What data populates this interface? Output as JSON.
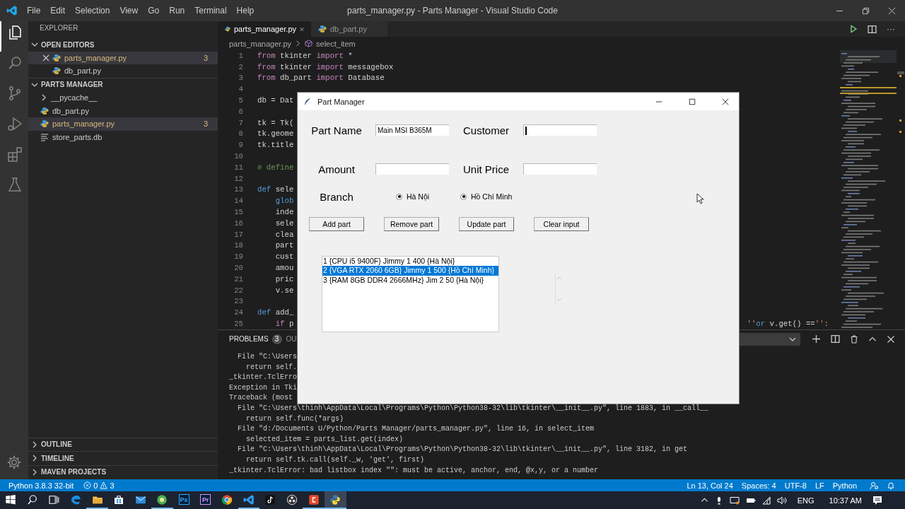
{
  "titlebar": {
    "menu": [
      "File",
      "Edit",
      "Selection",
      "View",
      "Go",
      "Run",
      "Terminal",
      "Help"
    ],
    "title": "parts_manager.py - Parts Manager - Visual Studio Code"
  },
  "activity": [
    {
      "kind": "files",
      "selected": true
    },
    {
      "kind": "search",
      "selected": false
    },
    {
      "kind": "source-control",
      "selected": false
    },
    {
      "kind": "run",
      "selected": false
    },
    {
      "kind": "extensions",
      "selected": false
    },
    {
      "kind": "flask",
      "selected": false
    }
  ],
  "sidebar": {
    "title": "EXPLORER",
    "sections": [
      {
        "label": "OPEN EDITORS",
        "expanded": true,
        "items": [
          {
            "label": "parts_manager.py",
            "kind": "python",
            "badge": "3",
            "modified": true,
            "selected": true
          },
          {
            "label": "db_part.py",
            "kind": "python",
            "modified": false,
            "selected": false
          }
        ]
      },
      {
        "label": "PARTS MANAGER",
        "expanded": true,
        "items": [
          {
            "label": "__pycache__",
            "kind": "folder",
            "modified": false,
            "selected": false
          },
          {
            "label": "db_part.py",
            "kind": "python",
            "modified": false,
            "selected": false
          },
          {
            "label": "parts_manager.py",
            "kind": "python",
            "badge": "3",
            "modified": true,
            "selected": true
          },
          {
            "label": "store_parts.db",
            "kind": "file",
            "modified": false,
            "selected": false
          }
        ]
      }
    ],
    "bottom_sections": [
      {
        "label": "OUTLINE",
        "expanded": false
      },
      {
        "label": "TIMELINE",
        "expanded": false
      },
      {
        "label": "MAVEN PROJECTS",
        "expanded": false
      }
    ]
  },
  "tabs": [
    {
      "label": "parts_manager.py",
      "selected": true
    },
    {
      "label": "db_part.py",
      "selected": false
    }
  ],
  "more": "···",
  "breadcrumb": [
    "parts_manager.py",
    "select_item"
  ],
  "code": [
    {
      "num": "1",
      "parts": [
        {
          "text": "from",
          "kind": "keyword"
        },
        {
          "text": " tkinter ",
          "kind": "plain"
        },
        {
          "text": "import",
          "kind": "keyword"
        },
        {
          "text": " *",
          "kind": "plain"
        }
      ]
    },
    {
      "num": "2",
      "parts": [
        {
          "text": "from",
          "kind": "keyword"
        },
        {
          "text": " tkinter ",
          "kind": "plain"
        },
        {
          "text": "import",
          "kind": "keyword"
        },
        {
          "text": " messagebox",
          "kind": "plain"
        }
      ]
    },
    {
      "num": "3",
      "parts": [
        {
          "text": "from",
          "kind": "keyword"
        },
        {
          "text": " db_part ",
          "kind": "plain"
        },
        {
          "text": "import",
          "kind": "keyword"
        },
        {
          "text": " Database",
          "kind": "plain"
        }
      ]
    },
    {
      "num": "4"
    },
    {
      "num": "5",
      "parts": [
        {
          "text": "db = Dat",
          "kind": "plain"
        }
      ]
    },
    {
      "num": "6"
    },
    {
      "num": "7",
      "parts": [
        {
          "text": "tk = Tk(",
          "kind": "plain"
        }
      ]
    },
    {
      "num": "8",
      "parts": [
        {
          "text": "tk.geome",
          "kind": "plain"
        }
      ]
    },
    {
      "num": "9",
      "parts": [
        {
          "text": "tk.title",
          "kind": "plain"
        }
      ]
    },
    {
      "num": "10"
    },
    {
      "num": "11",
      "parts": [
        {
          "text": "# define",
          "kind": "comment"
        }
      ]
    },
    {
      "num": "12"
    },
    {
      "num": "13",
      "parts": [
        {
          "text": "def",
          "kind": "storage"
        },
        {
          "text": " sele",
          "kind": "plain"
        }
      ]
    },
    {
      "num": "14",
      "parts": [
        {
          "text": "    glob",
          "kind": "storage"
        }
      ]
    },
    {
      "num": "15",
      "parts": [
        {
          "text": "    inde",
          "kind": "plain"
        }
      ]
    },
    {
      "num": "16",
      "parts": [
        {
          "text": "    sele",
          "kind": "plain"
        }
      ]
    },
    {
      "num": "17",
      "parts": [
        {
          "text": "    clea",
          "kind": "plain"
        }
      ]
    },
    {
      "num": "18",
      "parts": [
        {
          "text": "    part",
          "kind": "plain"
        }
      ]
    },
    {
      "num": "19",
      "parts": [
        {
          "text": "    cust",
          "kind": "plain"
        }
      ]
    },
    {
      "num": "20",
      "parts": [
        {
          "text": "    amou",
          "kind": "plain"
        }
      ]
    },
    {
      "num": "21",
      "parts": [
        {
          "text": "    pric",
          "kind": "plain"
        }
      ]
    },
    {
      "num": "22",
      "parts": [
        {
          "text": "    v.se",
          "kind": "plain"
        }
      ]
    },
    {
      "num": "23"
    },
    {
      "num": "24",
      "parts": [
        {
          "text": "def",
          "kind": "storage"
        },
        {
          "text": " add_",
          "kind": "plain"
        }
      ]
    },
    {
      "num": "25",
      "parts": [
        {
          "text": "    if",
          "kind": "keyword"
        },
        {
          "text": " p",
          "kind": "plain"
        }
      ],
      "tail": [
        {
          "text": "''",
          "kind": "string"
        },
        {
          "text": "or",
          "kind": "storage"
        },
        {
          "text": " v.get() ==",
          "kind": "plain"
        },
        {
          "text": "'':",
          "kind": "string"
        }
      ]
    }
  ],
  "panel": {
    "tabs": [
      {
        "label": "PROBLEMS",
        "badge": "3",
        "selected": true
      },
      {
        "label": "OU",
        "selected": false
      }
    ],
    "terminal": [
      "  File \"C:\\Users",
      "    return self.",
      "_tkinter.TclErro",
      "Exception in Tki",
      "Traceback (most",
      "  File \"C:\\Users\\thinh\\AppData\\Local\\Programs\\Python\\Python38-32\\lib\\tkinter\\__init__.py\", line 1883, in __call__",
      "    return self.func(*args)",
      "  File \"d:/Documents U/Python/Parts Manager/parts_manager.py\", line 16, in select_item",
      "    selected_item = parts_list.get(index)",
      "  File \"C:\\Users\\thinh\\AppData\\Local\\Programs\\Python\\Python38-32\\lib\\tkinter\\__init__.py\", line 3182, in get",
      "    return self.tk.call(self._w, 'get', first)",
      "_tkinter.TclError: bad listbox index \"\": must be active, anchor, end, @x,y, or a number"
    ]
  },
  "dialog": {
    "title": "Part Manager",
    "fields": [
      {
        "label": "Part Name",
        "value": "Main MSI B365M",
        "focused": false
      },
      {
        "label": "Customer",
        "focused": true
      },
      {
        "label": "Amount",
        "focused": false
      },
      {
        "label": "Unit Price",
        "focused": false
      }
    ],
    "branch": {
      "label": "Branch",
      "options": [
        {
          "label": "Hà Nội",
          "selected": true
        },
        {
          "label": "Hồ Chí Minh",
          "selected": true
        }
      ]
    },
    "buttons": [
      "Add part",
      "Remove part",
      "Update part",
      "Clear input"
    ],
    "list": [
      {
        "text": "1 {CPU i5 9400F} Jimmy 1 400 {Hà Nội}",
        "selected": false
      },
      {
        "text": "2 {VGA RTX 2060 6GB} Jimmy 1 500 {Hồ Chí Minh}",
        "selected": true
      },
      {
        "text": "3 {RAM 8GB DDR4 2666MHz} Jim 2 50 {Hà Nội}",
        "selected": false
      }
    ]
  },
  "status_bar": {
    "interpreter": "Python 3.8.3 32-bit",
    "errors": "0",
    "warnings": "3",
    "right": [
      "Ln 13, Col 24",
      "Spaces: 4",
      "UTF-8",
      "LF",
      "Python"
    ]
  },
  "taskbar": {
    "apps": [
      {
        "kind": "start",
        "running": false,
        "selected": false
      },
      {
        "kind": "search",
        "running": false,
        "selected": false
      },
      {
        "kind": "taskview",
        "running": false,
        "selected": false
      },
      {
        "kind": "edge",
        "running": false,
        "selected": false
      },
      {
        "kind": "folder",
        "running": true,
        "selected": false
      },
      {
        "kind": "store",
        "running": false,
        "selected": false
      },
      {
        "kind": "mail",
        "running": false,
        "selected": false
      },
      {
        "kind": "round",
        "running": true,
        "selected": false
      },
      {
        "kind": "tile",
        "label": "Ps",
        "color": "#31a8ff",
        "running": false,
        "selected": false
      },
      {
        "kind": "tile",
        "label": "Pr",
        "color": "#d291ff",
        "running": false,
        "selected": false
      },
      {
        "kind": "ring",
        "running": false,
        "selected": false
      },
      {
        "kind": "ribbon",
        "running": true,
        "selected": false
      },
      {
        "kind": "note",
        "running": false,
        "selected": false
      },
      {
        "kind": "dotted",
        "running": false,
        "selected": false
      },
      {
        "kind": "square",
        "running": true,
        "selected": false
      },
      {
        "kind": "snake",
        "running": true,
        "selected": true
      }
    ],
    "language": "ENG",
    "time": "10:37 AM"
  }
}
